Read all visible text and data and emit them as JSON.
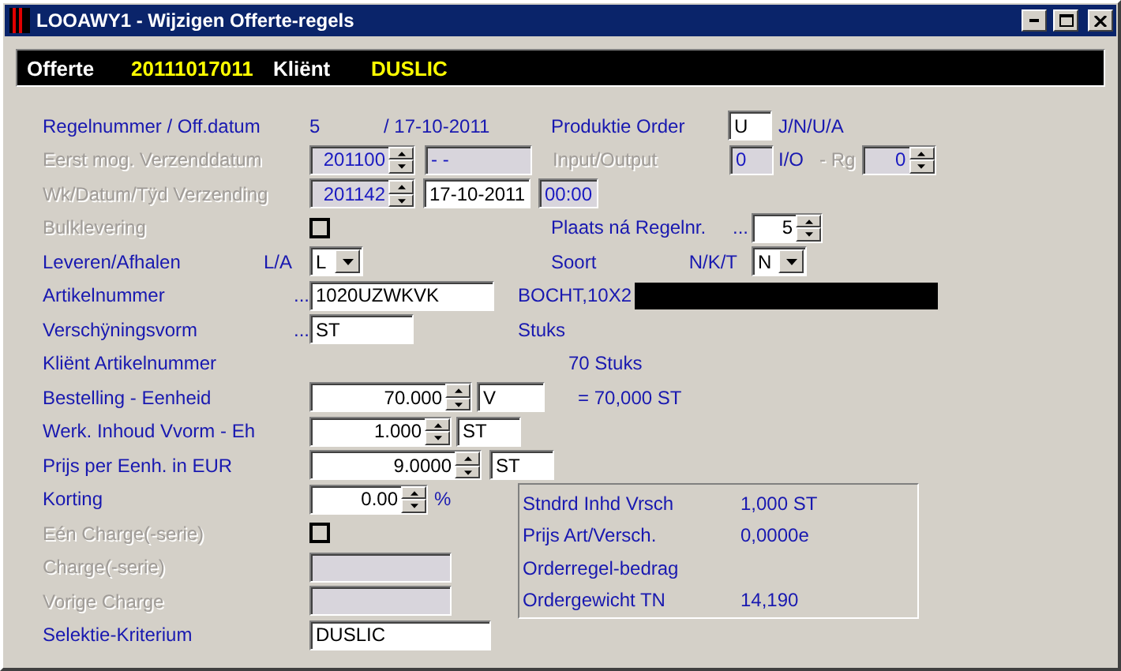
{
  "window": {
    "title": "LOOAWY1 - Wijzigen Offerte-regels"
  },
  "header": {
    "offerte_label": "Offerte",
    "offerte": "20111017011",
    "client_label": "Kliënt",
    "client": "DUSLIC"
  },
  "regelnummer": {
    "label": "Regelnummer / Off.datum",
    "value": "5",
    "date": "/ 17-10-2011"
  },
  "produktie_order": {
    "label": "Produktie Order",
    "value": "U",
    "hint": "J/N/U/A"
  },
  "eerst_mog": {
    "label": "Eerst mog. Verzenddatum",
    "disabled": true,
    "week": "201100",
    "date": "- -"
  },
  "input_output": {
    "label": "Input/Output",
    "disabled": true,
    "value": "0",
    "unit": "I/O",
    "rg_label": "- Rg",
    "rg": "0"
  },
  "verzending": {
    "label": "Wk/Datum/Tÿd Verzending",
    "disabled": true,
    "week": "201142",
    "date": "17-10-2011",
    "time": "00:00"
  },
  "bulklevering": {
    "label": "Bulklevering",
    "disabled": true,
    "checked": false
  },
  "plaats": {
    "label": "Plaats ná Regelnr.",
    "suffix": "...",
    "value": "5"
  },
  "leveren": {
    "label": "Leveren/Afhalen",
    "suffix": "L/A",
    "value": "L"
  },
  "soort": {
    "label": "Soort",
    "suffix": "N/K/T",
    "value": "N"
  },
  "artikelnummer": {
    "label": "Artikelnummer",
    "suffix": "...",
    "value": "1020UZWKVK",
    "description": "BOCHT,10X2"
  },
  "verschijningsvorm": {
    "label": "Verschÿningsvorm",
    "suffix": "...",
    "value": "ST",
    "description": "Stuks"
  },
  "klient_artikelnummer": {
    "label": "Kliënt Artikelnummer",
    "description": "70 Stuks"
  },
  "bestelling": {
    "label": "Bestelling - Eenheid",
    "value": "70.000",
    "unit": "V",
    "result": "= 70,000 ST"
  },
  "werk_inhoud": {
    "label": "Werk. Inhoud Vvorm - Eh",
    "value": "1.000",
    "unit": "ST"
  },
  "prijs": {
    "label": "Prijs per Eenh. in EUR",
    "value": "9.0000",
    "unit": "ST"
  },
  "korting": {
    "label": "Korting",
    "value": "0.00",
    "unit": "%"
  },
  "een_charge": {
    "label": "Eén Charge(-serie)",
    "disabled": true,
    "checked": false
  },
  "charge": {
    "label": "Charge(-serie)",
    "disabled": true
  },
  "vorige_charge": {
    "label": "Vorige Charge",
    "disabled": true
  },
  "selektie": {
    "label": "Selektie-Kriterium",
    "value": "DUSLIC"
  },
  "summary": [
    {
      "label": "Stndrd Inhd Vrsch",
      "value": "1,000 ST"
    },
    {
      "label": "Prijs Art/Versch.",
      "value": "0,0000e"
    },
    {
      "label": "Orderregel-bedrag"
    },
    {
      "label": "Ordergewicht TN",
      "value": "14,190"
    }
  ]
}
